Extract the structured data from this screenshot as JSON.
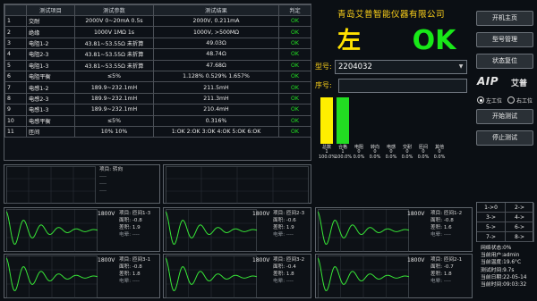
{
  "table": {
    "headers": [
      "测试项目",
      "测试参数",
      "测试结果",
      "判定"
    ],
    "rows": [
      {
        "no": "1",
        "item": "交耐",
        "param": "2000V 0~20mA 0.5s",
        "result": "2000V, 0.211mA",
        "verdict": "OK"
      },
      {
        "no": "2",
        "item": "绝缘",
        "param": "1000V 1MΩ 1s",
        "result": "1000V, >500MΩ",
        "verdict": "OK"
      },
      {
        "no": "3",
        "item": "电阻1-2",
        "param": "43.81~53.55Ω 未折算",
        "result": "49.03Ω",
        "verdict": "OK"
      },
      {
        "no": "4",
        "item": "电阻2-3",
        "param": "43.81~53.55Ω 未折算",
        "result": "48.74Ω",
        "verdict": "OK"
      },
      {
        "no": "5",
        "item": "电阻1-3",
        "param": "43.81~53.55Ω 未折算",
        "result": "47.68Ω",
        "verdict": "OK"
      },
      {
        "no": "6",
        "item": "电阻平衡",
        "param": "≤5%",
        "result": "1.128% 0.529% 1.657%",
        "verdict": "OK"
      },
      {
        "no": "7",
        "item": "电感1-2",
        "param": "189.9~232.1mH",
        "result": "211.5mH",
        "verdict": "OK"
      },
      {
        "no": "8",
        "item": "电感2-3",
        "param": "189.9~232.1mH",
        "result": "211.3mH",
        "verdict": "OK"
      },
      {
        "no": "9",
        "item": "电感1-3",
        "param": "189.9~232.1mH",
        "result": "210.4mH",
        "verdict": "OK"
      },
      {
        "no": "10",
        "item": "电感平衡",
        "param": "≤5%",
        "result": "0.316%",
        "verdict": "OK"
      },
      {
        "no": "11",
        "item": "匝间",
        "param": "10% 10%",
        "result": "1:OK 2:OK 3:OK 4:OK 5:OK 6:OK",
        "verdict": "OK"
      }
    ]
  },
  "header": {
    "company": "青岛艾普智能仪器有限公司",
    "side": "左",
    "verdict": "OK"
  },
  "model": {
    "label": "型号:",
    "value": "2204032"
  },
  "serial": {
    "label": "序号:",
    "value": ""
  },
  "bar_chart": {
    "bars": [
      {
        "name": "总数",
        "count": "1",
        "pct": "100.0%",
        "color": "#ffee00",
        "level": 1.0
      },
      {
        "name": "合格",
        "count": "1",
        "pct": "100.0%",
        "color": "#22dd22",
        "level": 1.0
      },
      {
        "name": "电阻",
        "count": "0",
        "pct": "0.0%",
        "color": "#dd2222",
        "level": 0
      },
      {
        "name": "转向",
        "count": "0",
        "pct": "0.0%",
        "color": "#dd2222",
        "level": 0
      },
      {
        "name": "电感",
        "count": "0",
        "pct": "0.0%",
        "color": "#dd2222",
        "level": 0
      },
      {
        "name": "交耐",
        "count": "0",
        "pct": "0.0%",
        "color": "#dd2222",
        "level": 0
      },
      {
        "name": "匝间",
        "count": "0",
        "pct": "0.0%",
        "color": "#dd2222",
        "level": 0
      },
      {
        "name": "其他",
        "count": "0",
        "pct": "0.0%",
        "color": "#dd2222",
        "level": 0
      }
    ]
  },
  "buttons": {
    "home": "开机主页",
    "model_mgmt": "型号管理",
    "status_reset": "状态复位",
    "start": "开始测试",
    "stop": "停止测试"
  },
  "logo": {
    "main": "AIP",
    "sub": "艾普"
  },
  "station": {
    "left": "左工位",
    "right": "右工位"
  },
  "waves": {
    "p1": {
      "title": "项目: 转向",
      "l2": "----",
      "l3": "----",
      "l4": "----"
    },
    "p3": {
      "volt": "1800V",
      "title": "项目: 匝间1-3",
      "l2": "面积: -0.8",
      "l3": "差积: 1.9",
      "l4": "电晕: ----"
    },
    "p4": {
      "volt": "1800V",
      "title": "项目: 匝间2-3",
      "l2": "面积: -0.6",
      "l3": "差积: 1.9",
      "l4": "电晕: ----"
    },
    "p5": {
      "volt": "1800V",
      "title": "项目: 匝间1-2",
      "l2": "面积: -0.8",
      "l3": "差积: 1.6",
      "l4": "电晕: ----"
    },
    "p6": {
      "volt": "1800V",
      "title": "项目: 匝间3-1",
      "l2": "面积: -0.8",
      "l3": "差积: 1.8",
      "l4": "电晕: ----"
    },
    "p7": {
      "volt": "1800V",
      "title": "项目: 匝间3-2",
      "l2": "面积: -0.4",
      "l3": "差积: 1.8",
      "l4": "电晕: ----"
    },
    "p8": {
      "volt": "1800V",
      "title": "项目: 匝间2-1",
      "l2": "面积: -0.7",
      "l3": "差积: 1.8",
      "l4": "电晕: ----"
    }
  },
  "direction": [
    [
      "1->0",
      "2->"
    ],
    [
      "3->",
      "4->"
    ],
    [
      "5->",
      "6->"
    ],
    [
      "7->",
      "8->"
    ]
  ],
  "status": {
    "net": "网络状态:0%",
    "user": "当前用户:admin",
    "temp": "当前温度:19.6°C",
    "humid": "测试时间:9.7s",
    "date": "当前日期:22-05-14",
    "time": "当前时间:09:03:32"
  }
}
